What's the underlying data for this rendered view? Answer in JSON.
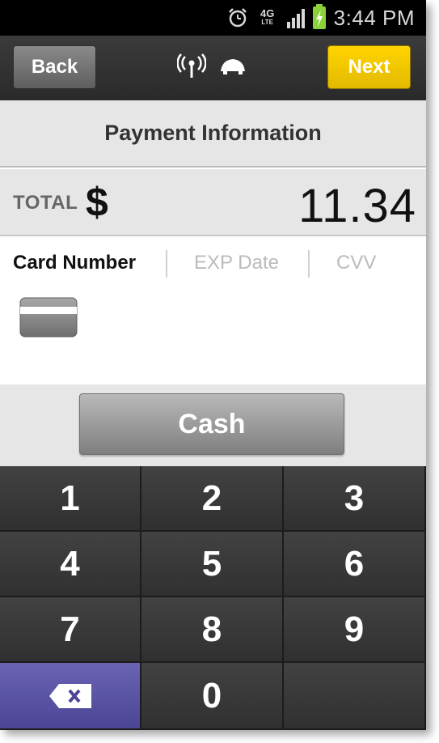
{
  "status_bar": {
    "network": "4G",
    "network_sub": "LTE",
    "time": "3:44 PM",
    "icons": [
      "alarm-icon",
      "network-4g-lte-icon",
      "signal-icon",
      "battery-charging-icon"
    ]
  },
  "action_bar": {
    "back_label": "Back",
    "next_label": "Next",
    "icons": [
      "card-reader-icon",
      "turtle-icon"
    ]
  },
  "title": "Payment Information",
  "total": {
    "label": "TOTAL",
    "currency": "$",
    "amount": "11.34"
  },
  "card_fields": {
    "card_number": "Card Number",
    "exp_date": "EXP Date",
    "cvv": "CVV"
  },
  "cash_label": "Cash",
  "keypad": {
    "keys": [
      "1",
      "2",
      "3",
      "4",
      "5",
      "6",
      "7",
      "8",
      "9",
      "0"
    ]
  },
  "colors": {
    "next_button": "#ffd500",
    "delete_key": "#5a53a6",
    "keypad_key": "#3a3a3a"
  }
}
